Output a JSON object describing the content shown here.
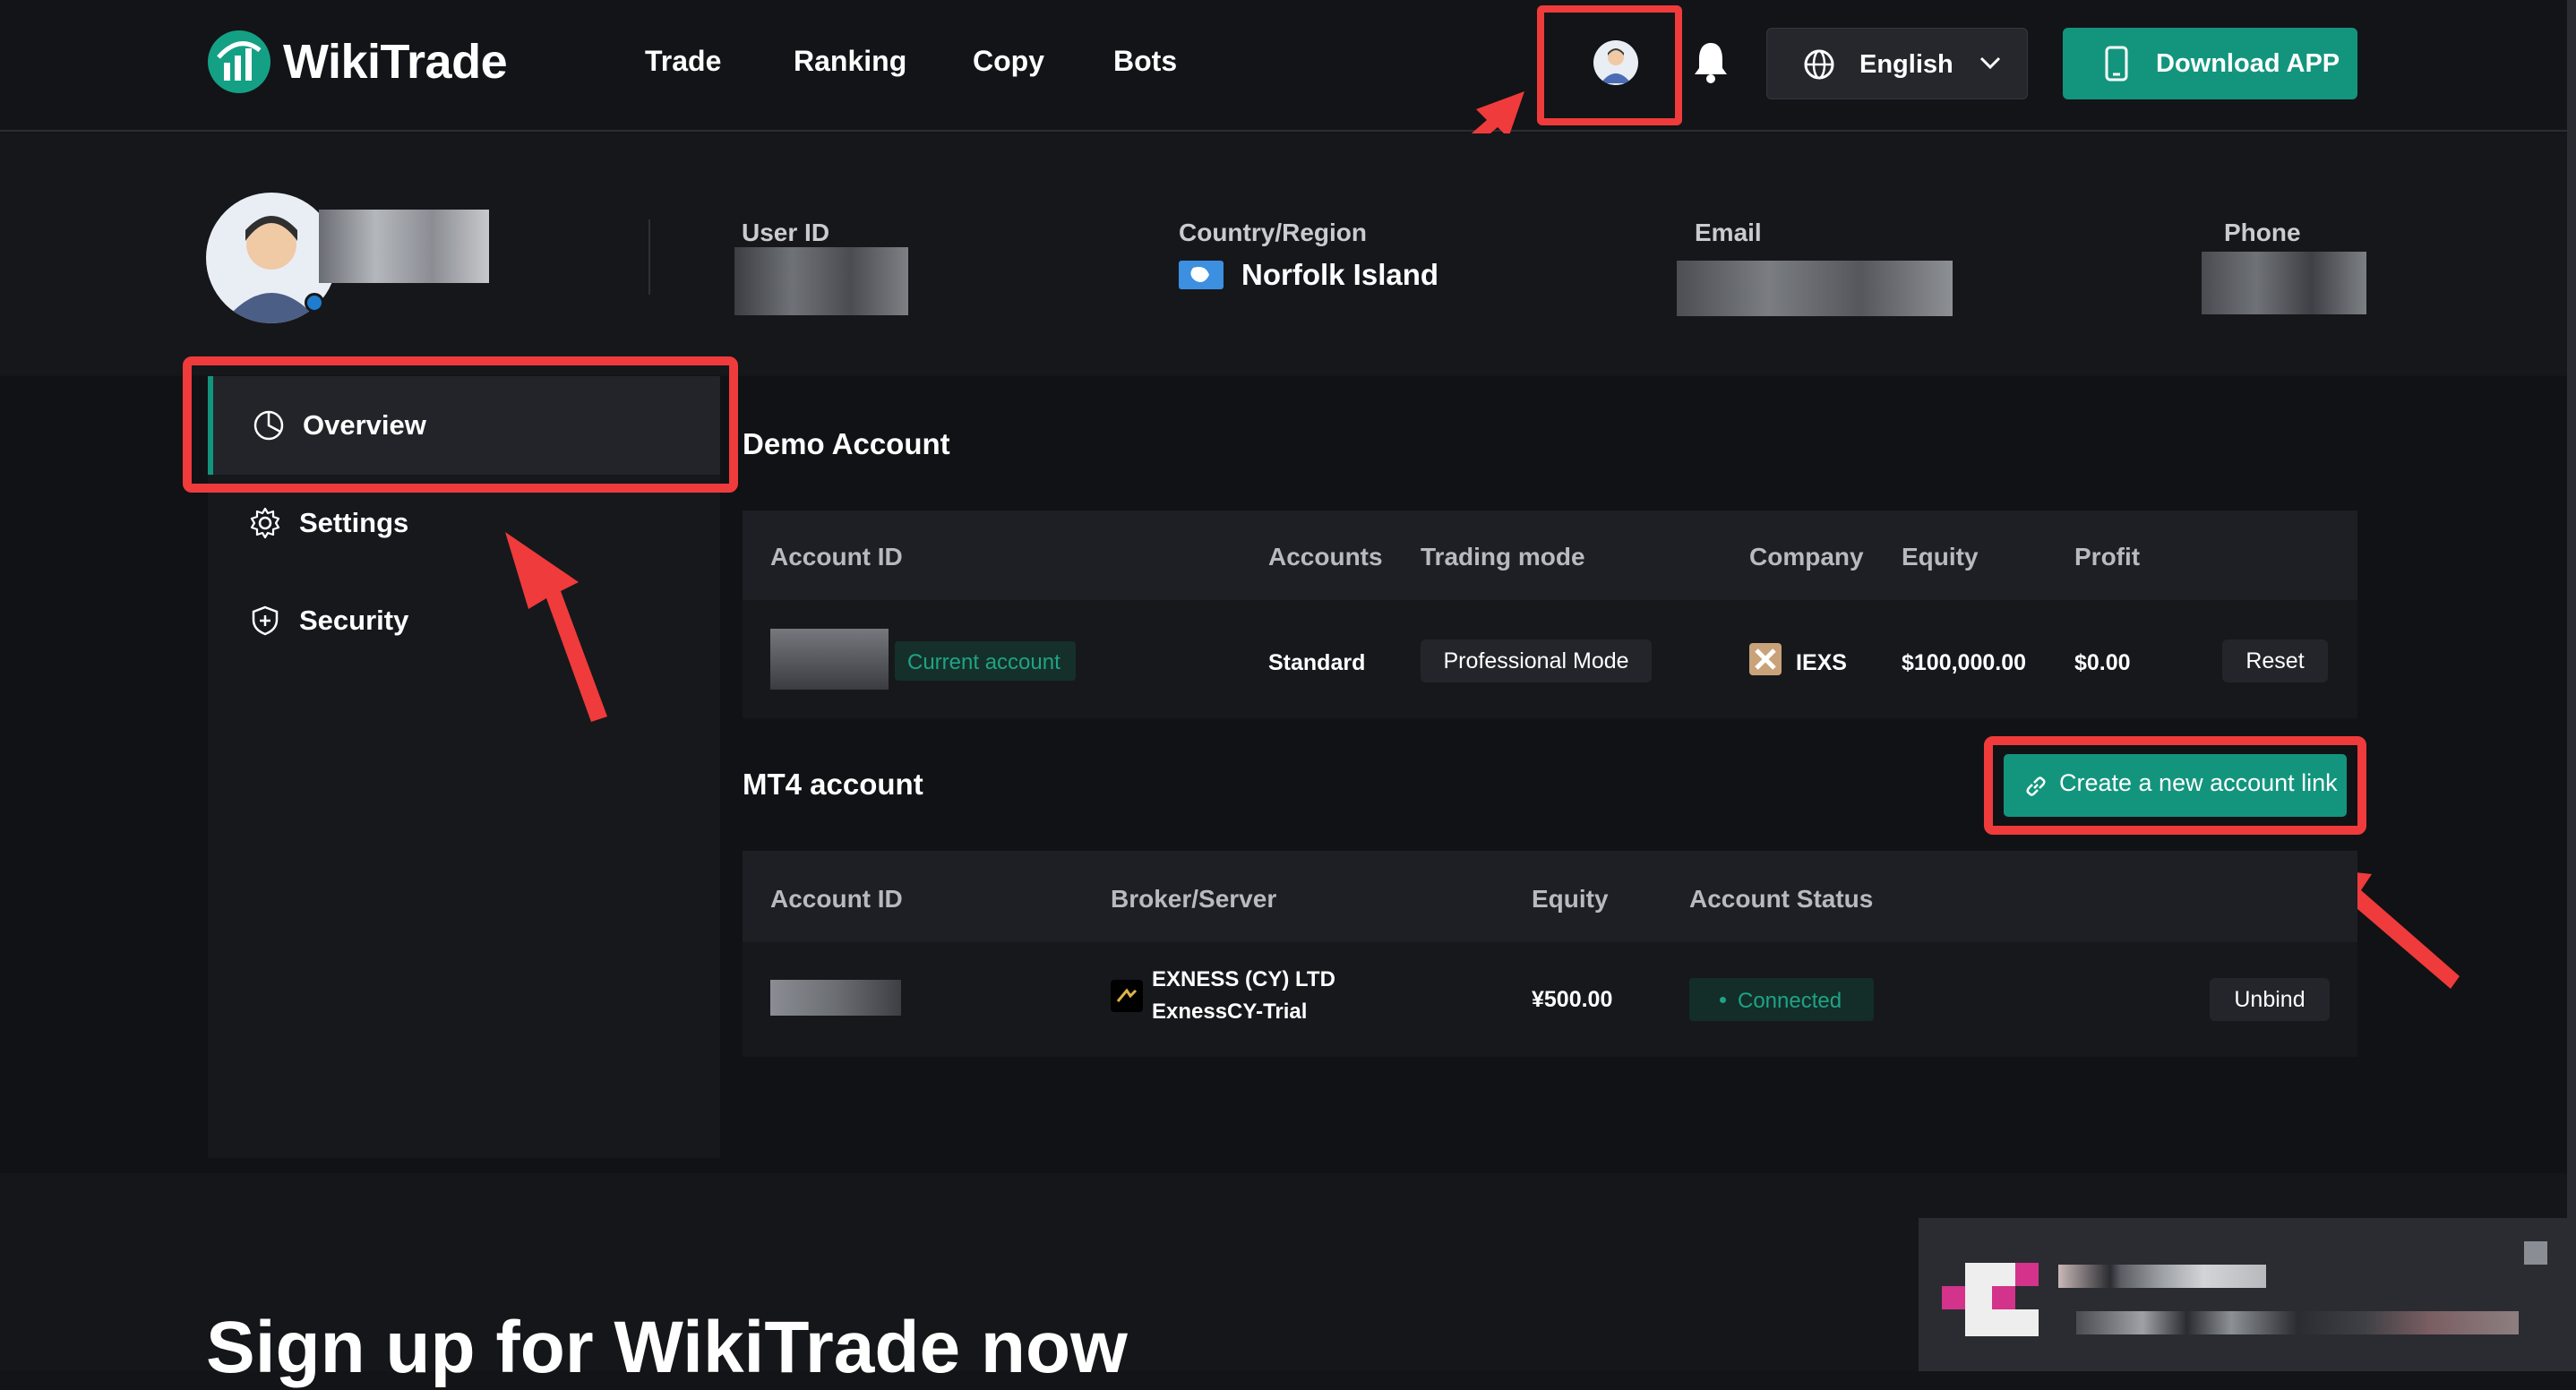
{
  "header": {
    "brand": "WikiTrade",
    "nav": [
      "Trade",
      "Ranking",
      "Copy",
      "Bots"
    ],
    "language": "English",
    "download_label": "Download APP"
  },
  "profile": {
    "fields": [
      {
        "label": "User ID",
        "value": ""
      },
      {
        "label": "Country/Region",
        "value": "Norfolk Island"
      },
      {
        "label": "Email",
        "value": ""
      },
      {
        "label": "Phone",
        "value": ""
      }
    ]
  },
  "sidebar": {
    "items": [
      {
        "label": "Overview",
        "icon": "pie-chart-icon",
        "active": true
      },
      {
        "label": "Settings",
        "icon": "gear-icon"
      },
      {
        "label": "Security",
        "icon": "shield-icon"
      }
    ]
  },
  "demo": {
    "title": "Demo Account",
    "columns": [
      "Account ID",
      "Accounts",
      "Trading mode",
      "Company",
      "Equity",
      "Profit"
    ],
    "row": {
      "badge": "Current account",
      "accounts": "Standard",
      "mode": "Professional Mode",
      "company": "IEXS",
      "equity": "$100,000.00",
      "profit": "$0.00",
      "action": "Reset"
    }
  },
  "mt4": {
    "title": "MT4 account",
    "create_label": "Create a new account link",
    "columns": [
      "Account ID",
      "Broker/Server",
      "Equity",
      "Account Status"
    ],
    "row": {
      "broker": "EXNESS (CY) LTD",
      "server": "ExnessCY-Trial",
      "equity": "¥500.00",
      "status": "Connected",
      "action": "Unbind"
    }
  },
  "signup": {
    "title": "Sign up for WikiTrade now"
  },
  "colors": {
    "accent": "#13957d",
    "highlight": "#ef3b3b",
    "background": "#131417"
  }
}
